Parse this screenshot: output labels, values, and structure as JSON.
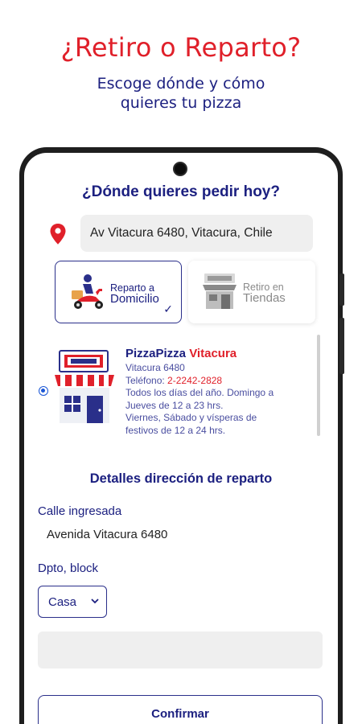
{
  "promo": {
    "headline": "¿Retiro o Reparto?",
    "subtitle_line1": "Escoge dónde y cómo",
    "subtitle_line2": "quieres tu pizza"
  },
  "app": {
    "question": "¿Dónde quieres pedir hoy?",
    "address": "Av Vitacura 6480, Vitacura, Chile",
    "options": {
      "delivery": {
        "line1": "Reparto a",
        "line2": "Domicilio",
        "selected": true
      },
      "pickup": {
        "line1": "Retiro en",
        "line2": "Tiendas",
        "selected": false
      }
    },
    "store": {
      "name_brand": "PizzaPizza",
      "name_branch": "Vitacura",
      "address": "Vitacura 6480",
      "phone_label": "Teléfono:",
      "phone_number": "2-2242-2828",
      "hours1": "Todos los días del año. Domingo a",
      "hours2": "Jueves de 12 a 23 hrs.",
      "hours3": "Viernes, Sábado y vísperas de",
      "hours4": "festivos de 12 a 24 hrs.",
      "selected": true
    },
    "details": {
      "title": "Detalles dirección de reparto",
      "street_label": "Calle ingresada",
      "street_value": "Avenida Vitacura 6480",
      "unit_label": "Dpto, block",
      "unit_type_selected": "Casa",
      "unit_number_value": ""
    },
    "confirm_label": "Confirmar"
  },
  "colors": {
    "brand_red": "#e0202a",
    "brand_navy": "#1c2080",
    "field_gray": "#efefef"
  },
  "icons": {
    "location": "map-pin-icon",
    "delivery": "scooter-delivery-icon",
    "pickup": "storefront-icon",
    "store": "pizzapizza-store-icon",
    "check": "checkmark-icon",
    "select": "chevron-down-icon"
  }
}
